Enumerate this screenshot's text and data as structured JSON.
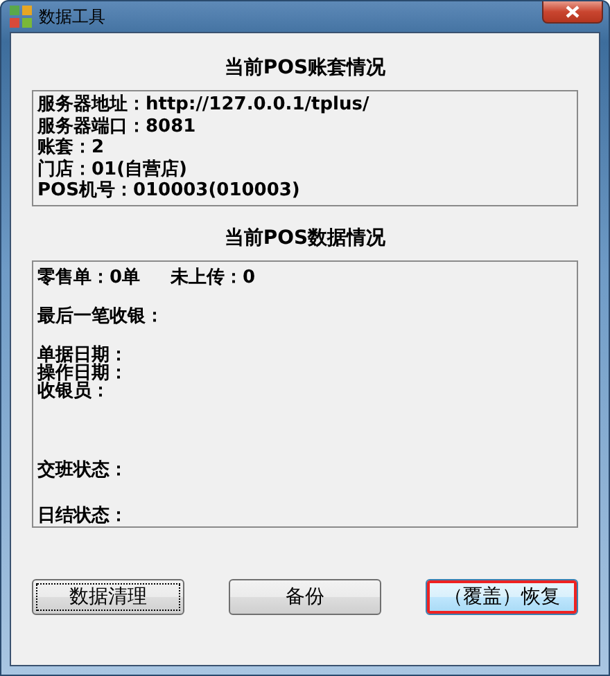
{
  "window": {
    "title": "数据工具"
  },
  "account_section": {
    "title": "当前POS账套情况",
    "lines": [
      "服务器地址：http://127.0.0.1/tplus/",
      "服务器端口：8081",
      "账套：2",
      "门店：01(自营店)",
      "POS机号：010003(010003)"
    ]
  },
  "data_section": {
    "title": "当前POS数据情况",
    "groups": [
      [
        [
          "零售单：0单",
          "未上传：0"
        ]
      ],
      [
        [
          "最后一笔收银："
        ]
      ],
      [
        [
          "单据日期："
        ],
        [
          "操作日期："
        ],
        [
          "收银员："
        ]
      ],
      [
        [
          "交班状态："
        ]
      ],
      [
        [
          "日结状态："
        ]
      ]
    ]
  },
  "buttons": [
    {
      "label": "数据清理",
      "focused": true,
      "highlighted": false,
      "hovered": false
    },
    {
      "label": "备份",
      "focused": false,
      "highlighted": false,
      "hovered": false
    },
    {
      "label": "（覆盖）恢复",
      "focused": false,
      "highlighted": true,
      "hovered": true
    }
  ]
}
